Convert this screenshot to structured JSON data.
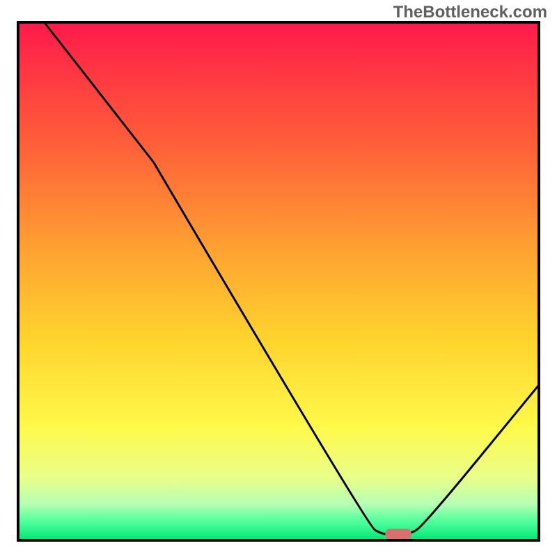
{
  "watermark": "TheBottleneck.com",
  "colors": {
    "gradient_top": "#ff1a4a",
    "gradient_mid_upper": "#ff6a36",
    "gradient_mid": "#ffb52e",
    "gradient_mid_lower": "#ffe22e",
    "gradient_lower": "#f7ff5e",
    "gradient_pale": "#d9ffb0",
    "gradient_green": "#00e676",
    "curve_stroke": "#000000",
    "marker_fill": "#d97070",
    "frame_stroke": "#000000"
  },
  "chart_data": {
    "type": "line",
    "title": "",
    "xlabel": "",
    "ylabel": "",
    "xlim": [
      0,
      100
    ],
    "ylim": [
      0,
      100
    ],
    "curve_points": [
      {
        "x": 5,
        "y": 100
      },
      {
        "x": 26,
        "y": 73
      },
      {
        "x": 67,
        "y": 3
      },
      {
        "x": 70,
        "y": 1
      },
      {
        "x": 75,
        "y": 1
      },
      {
        "x": 78,
        "y": 3
      },
      {
        "x": 100,
        "y": 30
      }
    ],
    "optimum_marker": {
      "x": 73,
      "y": 1.2,
      "width": 5,
      "height": 2
    },
    "gradient_stops": [
      {
        "pos": 0.0,
        "color": "#ff1a4a"
      },
      {
        "pos": 0.22,
        "color": "#ff5a3a"
      },
      {
        "pos": 0.45,
        "color": "#ffa531"
      },
      {
        "pos": 0.62,
        "color": "#ffd52e"
      },
      {
        "pos": 0.78,
        "color": "#fff94a"
      },
      {
        "pos": 0.88,
        "color": "#e8ff8a"
      },
      {
        "pos": 0.93,
        "color": "#b6ffb4"
      },
      {
        "pos": 0.965,
        "color": "#4cff9a"
      },
      {
        "pos": 1.0,
        "color": "#00e676"
      }
    ]
  }
}
